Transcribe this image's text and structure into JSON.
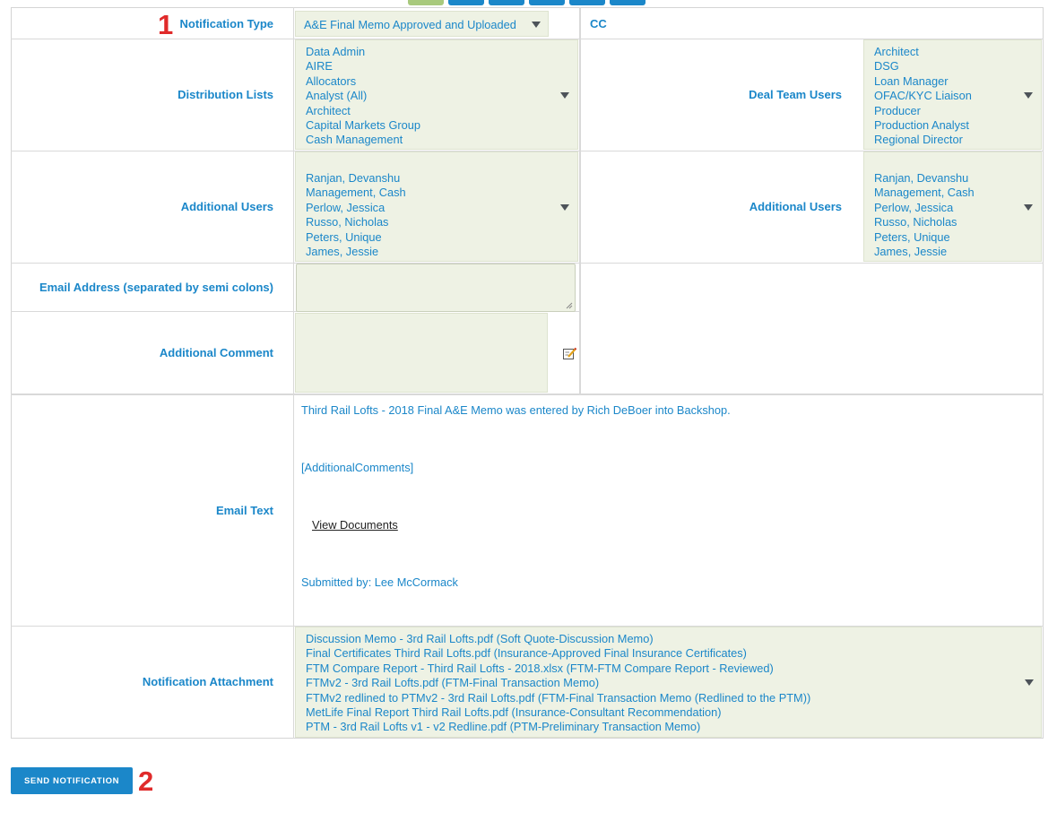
{
  "colors": {
    "accent": "#1b87c9",
    "select_bg": "#eef2e4",
    "marker_red": "#e02a2a",
    "top_green": "#a8c97d"
  },
  "markers": {
    "one": "1",
    "two": "2"
  },
  "notification_type": {
    "label": "Notification Type",
    "value": "A&E Final Memo Approved and Uploaded"
  },
  "cc": {
    "label": "CC"
  },
  "distribution_lists": {
    "label": "Distribution Lists",
    "items": [
      "Data Admin",
      "AIRE",
      "Allocators",
      "Analyst (All)",
      "Architect",
      "Capital Markets Group",
      "Cash Management"
    ]
  },
  "deal_team_users": {
    "label": "Deal Team Users",
    "items": [
      "Architect",
      "DSG",
      "Loan Manager",
      "OFAC/KYC Liaison",
      "Producer",
      "Production Analyst",
      "Regional Director"
    ]
  },
  "additional_users_left": {
    "label": "Additional Users",
    "items": [
      "Ranjan, Devanshu",
      "Management, Cash",
      "Perlow, Jessica",
      "Russo, Nicholas",
      "Peters, Unique",
      "James, Jessie"
    ]
  },
  "additional_users_right": {
    "label": "Additional Users",
    "items": [
      "Ranjan, Devanshu",
      "Management, Cash",
      "Perlow, Jessica",
      "Russo, Nicholas",
      "Peters, Unique",
      "James, Jessie"
    ]
  },
  "email_address": {
    "label": "Email Address (separated by semi colons)",
    "value": ""
  },
  "additional_comment": {
    "label": "Additional Comment",
    "value": "",
    "icon": "edit-note-icon"
  },
  "email_text": {
    "label": "Email Text",
    "line1": "Third Rail Lofts - 2018 Final A&E Memo was entered by Rich DeBoer into Backshop.",
    "placeholder": "[AdditionalComments]",
    "link": "View Documents",
    "submitted": "Submitted by: Lee McCormack"
  },
  "notification_attachment": {
    "label": "Notification Attachment",
    "items": [
      "Discussion Memo - 3rd Rail Lofts.pdf (Soft Quote-Discussion Memo)",
      "Final Certificates Third Rail Lofts.pdf (Insurance-Approved Final Insurance Certificates)",
      "FTM Compare Report - Third Rail Lofts - 2018.xlsx (FTM-FTM Compare Report - Reviewed)",
      "FTMv2 - 3rd Rail Lofts.pdf (FTM-Final Transaction Memo)",
      "FTMv2 redlined to PTMv2 - 3rd Rail Lofts.pdf (FTM-Final Transaction Memo (Redlined to the PTM))",
      "MetLife Final Report Third Rail Lofts.pdf (Insurance-Consultant Recommendation)",
      "PTM - 3rd Rail Lofts v1 - v2 Redline.pdf (PTM-Preliminary Transaction Memo)"
    ]
  },
  "send_button": {
    "label": "SEND NOTIFICATION"
  }
}
